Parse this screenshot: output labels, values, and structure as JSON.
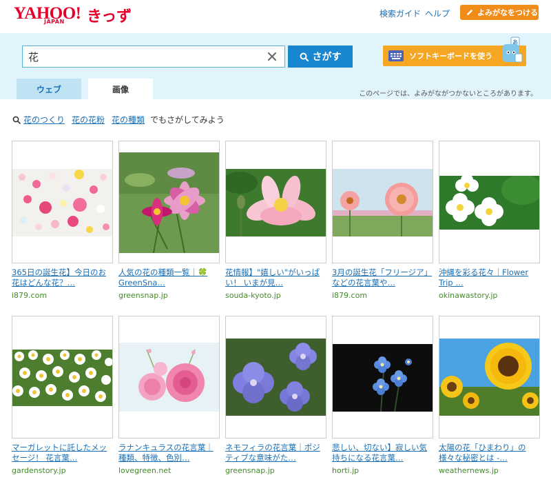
{
  "header": {
    "logo_main": "YAHOO!",
    "logo_sub": "JAPAN",
    "logo_kids": "きっず",
    "links": [
      "検索ガイド",
      "ヘルプ"
    ],
    "yomigana_button": "よみがなをつける"
  },
  "search": {
    "query": "花",
    "button_label": "さがす",
    "keyboard_button": "ソフトキーボードを使う"
  },
  "tabs": [
    {
      "label": "ウェブ",
      "active": false
    },
    {
      "label": "画像",
      "active": true
    }
  ],
  "notice": "このページでは、よみがながつかないところがあります。",
  "suggestions": {
    "links": [
      "花のつくり",
      "花の花粉",
      "花の種類"
    ],
    "suffix": "でもさがしてみよう"
  },
  "results": [
    {
      "title": "365日の誕生花】今日のお花はどんな花？…",
      "site": "i879.com",
      "image": "colorful-flower-heads"
    },
    {
      "title": "人気の花の種類一覧｜🍀 GreenSna…",
      "site": "greensnap.jp",
      "image": "pink-cosmos"
    },
    {
      "title": "花情報】\"嬉しい\"がいっぱい！ いまが見…",
      "site": "souda-kyoto.jp",
      "image": "pink-lotus"
    },
    {
      "title": "3月の誕生花「フリージア」などの花言葉や…",
      "site": "i879.com",
      "image": "pink-gerbera"
    },
    {
      "title": "沖縄を彩る花々｜Flower Trip …",
      "site": "okinawastory.jp",
      "image": "white-plumeria"
    },
    {
      "title": "マーガレットに託したメッセージ！ 花言葉…",
      "site": "gardenstory.jp",
      "image": "white-daisies"
    },
    {
      "title": "ラナンキュラスの花言葉｜種類、特徴、色別…",
      "site": "lovegreen.net",
      "image": "pink-ranunculus"
    },
    {
      "title": "ネモフィラの花言葉｜ポジティブな意味がた…",
      "site": "greensnap.jp",
      "image": "blue-geranium"
    },
    {
      "title": "悲しい、切ない】寂しい気持ちになる花言葉…",
      "site": "horti.jp",
      "image": "blue-forget-me-not"
    },
    {
      "title": "太陽の花「ひまわり」の様々な秘密とは -…",
      "site": "weathernews.jp",
      "image": "sunflowers"
    }
  ],
  "colors": {
    "brand_red": "#e4002b",
    "link_blue": "#1a6fb5",
    "band_bg": "#e1f3fb",
    "search_button": "#1987d0",
    "orange": "#f08c1a",
    "site_green": "#448a2b"
  }
}
